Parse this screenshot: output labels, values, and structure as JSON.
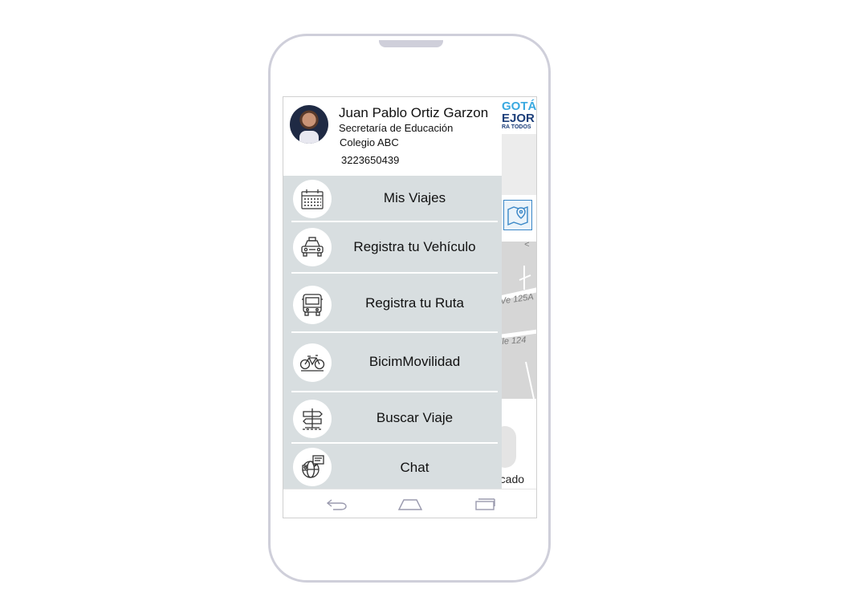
{
  "background_app": {
    "logo_line1": "GOTÁ",
    "logo_line2": "EJOR",
    "logo_line3": "RA TODOS",
    "road_1": "Ve 125A",
    "road_2": "lle 124",
    "road_3": "<",
    "partial_label": "rcado"
  },
  "profile": {
    "name": "Juan Pablo Ortiz Garzon",
    "role": "Secretaría de Educación",
    "school": "Colegio ABC",
    "phone": "3223650439"
  },
  "menu": {
    "items": [
      {
        "label": "Mis Viajes",
        "icon": "calendar-icon"
      },
      {
        "label": "Registra tu Vehículo",
        "icon": "car-icon"
      },
      {
        "label": "Registra tu Ruta",
        "icon": "bus-icon"
      },
      {
        "label": "BicimMovilidad",
        "icon": "bicycle-icon"
      },
      {
        "label": "Buscar Viaje",
        "icon": "signpost-icon"
      },
      {
        "label": "Chat",
        "icon": "chat-globe-icon"
      }
    ]
  },
  "navbar": {
    "back": "back-icon",
    "home": "home-icon",
    "recents": "recents-icon"
  },
  "colors": {
    "menu_bg": "#d8dee0",
    "phone_frame": "#cfcfda",
    "accent_blue": "#39a9e0"
  }
}
